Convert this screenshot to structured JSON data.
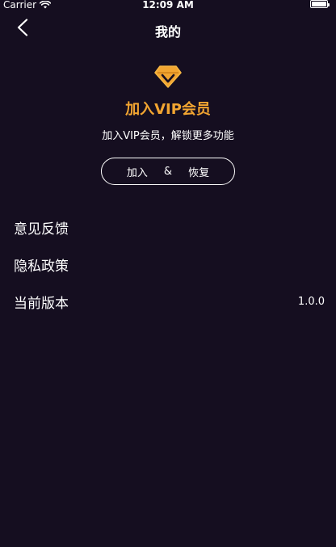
{
  "status_bar": {
    "carrier": "Carrier",
    "time": "12:09 AM"
  },
  "nav": {
    "title": "我的"
  },
  "vip": {
    "title": "加入VIP会员",
    "subtitle": "加入VIP会员，解锁更多功能",
    "button": {
      "join": "加入",
      "amp": "&",
      "restore": "恢复"
    }
  },
  "menu": {
    "items": [
      {
        "label": "意见反馈",
        "value": ""
      },
      {
        "label": "隐私政策",
        "value": ""
      },
      {
        "label": "当前版本",
        "value": "1.0.0"
      }
    ]
  },
  "colors": {
    "background": "#150e20",
    "accent": "#f2a531",
    "text": "#ffffff"
  },
  "icons": {
    "back": "chevron-left-icon",
    "vip": "diamond-icon",
    "wifi": "wifi-icon",
    "battery": "battery-icon"
  }
}
